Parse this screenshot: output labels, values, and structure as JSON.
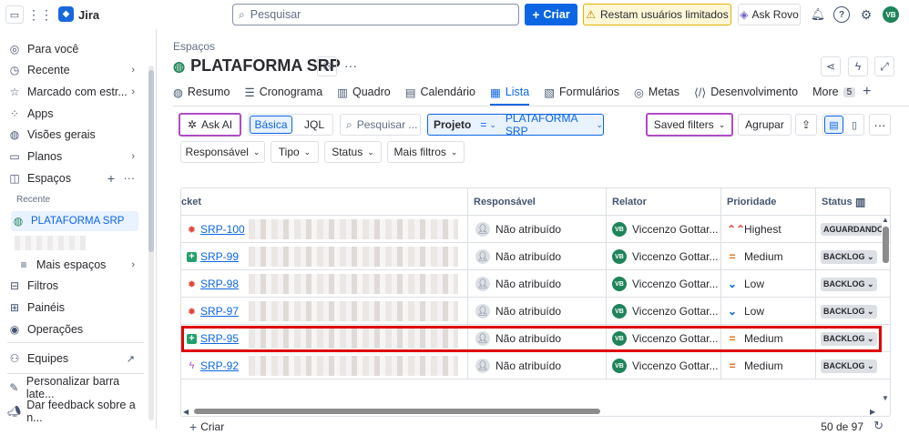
{
  "topbar": {
    "app_name": "Jira",
    "search_placeholder": "Pesquisar",
    "create_label": "Criar",
    "warning_label": "Restam usuários limitados",
    "rovo_label": "Ask Rovo",
    "user_initials": "VB"
  },
  "sidebar": {
    "items": [
      {
        "label": "Para você",
        "icon": "user-circle-icon"
      },
      {
        "label": "Recente",
        "icon": "clock-icon"
      },
      {
        "label": "Marcado com estr...",
        "icon": "star-icon"
      },
      {
        "label": "Apps",
        "icon": "apps-icon"
      },
      {
        "label": "Visões gerais",
        "icon": "globe-icon"
      },
      {
        "label": "Planos",
        "icon": "plans-icon"
      },
      {
        "label": "Espaços",
        "icon": "spaces-icon"
      }
    ],
    "recent_heading": "Recente",
    "selected_space": "PLATAFORMA SRP",
    "more_spaces": "Mais espaços",
    "items2": [
      {
        "label": "Filtros",
        "icon": "filter-icon"
      },
      {
        "label": "Painéis",
        "icon": "dashboard-icon"
      },
      {
        "label": "Operações",
        "icon": "operations-icon"
      },
      {
        "label": "Equipes",
        "icon": "teams-icon"
      },
      {
        "label": "Personalizar barra late...",
        "icon": "customize-icon"
      },
      {
        "label": "Dar feedback sobre a n...",
        "icon": "megaphone-icon"
      }
    ]
  },
  "main": {
    "breadcrumb": "Espaços",
    "title": "PLATAFORMA SRP",
    "tabs": [
      {
        "label": "Resumo",
        "icon": "globe-icon"
      },
      {
        "label": "Cronograma",
        "icon": "timeline-icon"
      },
      {
        "label": "Quadro",
        "icon": "board-icon"
      },
      {
        "label": "Calendário",
        "icon": "calendar-icon"
      },
      {
        "label": "Lista",
        "icon": "list-icon"
      },
      {
        "label": "Formulários",
        "icon": "forms-icon"
      },
      {
        "label": "Metas",
        "icon": "goals-icon"
      },
      {
        "label": "Desenvolvimento",
        "icon": "code-icon"
      }
    ],
    "more_tab": "More",
    "more_count": "5"
  },
  "filters": {
    "ask_ai": "Ask AI",
    "basic": "Básica",
    "jql": "JQL",
    "search_placeholder": "Pesquisar ...",
    "project_label": "Projeto",
    "project_op": "=",
    "project_value": "PLATAFORMA SRP",
    "saved_filters": "Saved filters",
    "group": "Agrupar",
    "assignee": "Responsável",
    "type": "Tipo",
    "status": "Status",
    "more_filters": "Mais filtros"
  },
  "table": {
    "columns": [
      "cket",
      "Responsável",
      "Relator",
      "Prioridade",
      "Status"
    ],
    "rows": [
      {
        "key": "SRP-100",
        "type": "bug",
        "assignee": "Não atribuído",
        "reporter": "Viccenzo Gottar...",
        "priority": "Highest",
        "priority_symbol": "⌃⌃",
        "status": "AGUARDANDO"
      },
      {
        "key": "SRP-99",
        "type": "story",
        "assignee": "Não atribuído",
        "reporter": "Viccenzo Gottar...",
        "priority": "Medium",
        "priority_symbol": "=",
        "status": "BACKLOG"
      },
      {
        "key": "SRP-98",
        "type": "bug",
        "assignee": "Não atribuído",
        "reporter": "Viccenzo Gottar...",
        "priority": "Low",
        "priority_symbol": "⌄",
        "status": "BACKLOG"
      },
      {
        "key": "SRP-97",
        "type": "bug",
        "assignee": "Não atribuído",
        "reporter": "Viccenzo Gottar...",
        "priority": "Low",
        "priority_symbol": "⌄",
        "status": "BACKLOG"
      },
      {
        "key": "SRP-95",
        "type": "story",
        "assignee": "Não atribuído",
        "reporter": "Viccenzo Gottar...",
        "priority": "Medium",
        "priority_symbol": "=",
        "status": "BACKLOG"
      },
      {
        "key": "SRP-92",
        "type": "epic",
        "assignee": "Não atribuído",
        "reporter": "Viccenzo Gottar...",
        "priority": "Medium",
        "priority_symbol": "=",
        "status": "BACKLOG"
      }
    ],
    "reporter_initials": "VB",
    "create_label": "Criar",
    "count": "50 de 97"
  },
  "colors": {
    "accent": "#0c66e4",
    "highlight": "#e00000",
    "ai_border": "#ae4bc4",
    "avatar": "#1f845a"
  }
}
